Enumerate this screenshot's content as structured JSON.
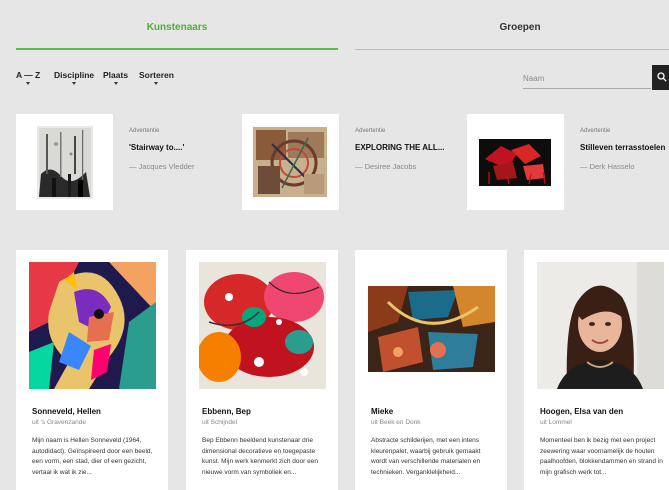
{
  "tabs": [
    {
      "label": "Kunstenaars",
      "active": true
    },
    {
      "label": "Groepen",
      "active": false
    }
  ],
  "filters": [
    "A — Z",
    "Discipline",
    "Plaats",
    "Sorteren"
  ],
  "search": {
    "placeholder": "Naam",
    "icon": "search-icon"
  },
  "colors": {
    "accent": "#4caf35",
    "background": "#e6e6e6",
    "search_button": "#222222"
  },
  "ads": [
    {
      "label": "Advertentie",
      "title": "'Stairway to....'",
      "author": "— Jacques Vledder"
    },
    {
      "label": "Advertentie",
      "title": "EXPLORING THE ALL...",
      "author": "— Desiree Jacobs"
    },
    {
      "label": "Advertentie",
      "title": "Stilleven terrasstoelen",
      "author": "— Derk Hasselo"
    }
  ],
  "artists": [
    {
      "name": "Sonneveld, Hellen",
      "location": "uit 's Gravenzande",
      "description": "Mijn naam is Hellen Sonneveld (1964, autodidact). Geïnspireerd door een beeld, een vorm, een stad, dier of een gezicht, vertaal ik wat ik zie..."
    },
    {
      "name": "Ebbenn, Bep",
      "location": "uit Schijndel",
      "description": "Bep Ebbenn beeldend kunstenaar drie dimensional decoratieve en toegepaste kunst. Mijn werk kenmerkt zich door een nieuwe vorm van symboliek en..."
    },
    {
      "name": "Mieke",
      "location": "uit Beek en Donk",
      "description": "Abstracte schilderijen, met een intens kleurenpalet, waarbij gebruik gemaakt wordt van verschillende materialen en technieken. Verganklelijkheid..."
    },
    {
      "name": "Hoogen, Elsa van den",
      "location": "uit Lommel",
      "description": "Momenteel ben ik bezig met een project zeewering waar voornamelijk de houten paalhoofden, blokkendammen en strand in mijn grafisch werk tot..."
    }
  ]
}
